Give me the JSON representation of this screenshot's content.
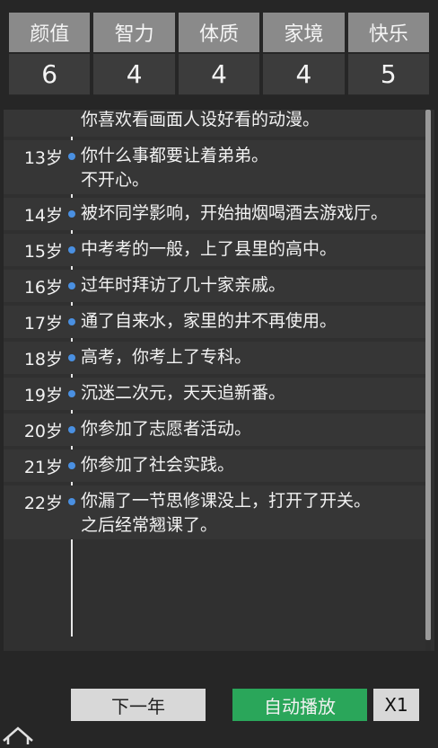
{
  "stats": [
    {
      "label": "颜值",
      "value": "6"
    },
    {
      "label": "智力",
      "value": "4"
    },
    {
      "label": "体质",
      "value": "4"
    },
    {
      "label": "家境",
      "value": "4"
    },
    {
      "label": "快乐",
      "value": "5"
    }
  ],
  "log": {
    "partial_top": "你喜欢看画面人设好看的动漫。",
    "entries": [
      {
        "age": "13岁",
        "text": "你什么事都要让着弟弟。\n不开心。"
      },
      {
        "age": "14岁",
        "text": "被坏同学影响，开始抽烟喝酒去游戏厅。"
      },
      {
        "age": "15岁",
        "text": "中考考的一般，上了县里的高中。"
      },
      {
        "age": "16岁",
        "text": "过年时拜访了几十家亲戚。"
      },
      {
        "age": "17岁",
        "text": "通了自来水，家里的井不再使用。"
      },
      {
        "age": "18岁",
        "text": "高考，你考上了专科。"
      },
      {
        "age": "19岁",
        "text": "沉迷二次元，天天追新番。"
      },
      {
        "age": "20岁",
        "text": "你参加了志愿者活动。"
      },
      {
        "age": "21岁",
        "text": "你参加了社会实践。"
      },
      {
        "age": "22岁",
        "text": "你漏了一节思修课没上，打开了开关。\n之后经常翘课了。"
      }
    ]
  },
  "buttons": {
    "next_year": "下一年",
    "auto_play": "自动播放",
    "speed": "X1"
  },
  "icons": {
    "home": "home-icon"
  },
  "colors": {
    "auto_play_bg": "#2aa65a",
    "timeline_dot": "#4a90e2"
  }
}
